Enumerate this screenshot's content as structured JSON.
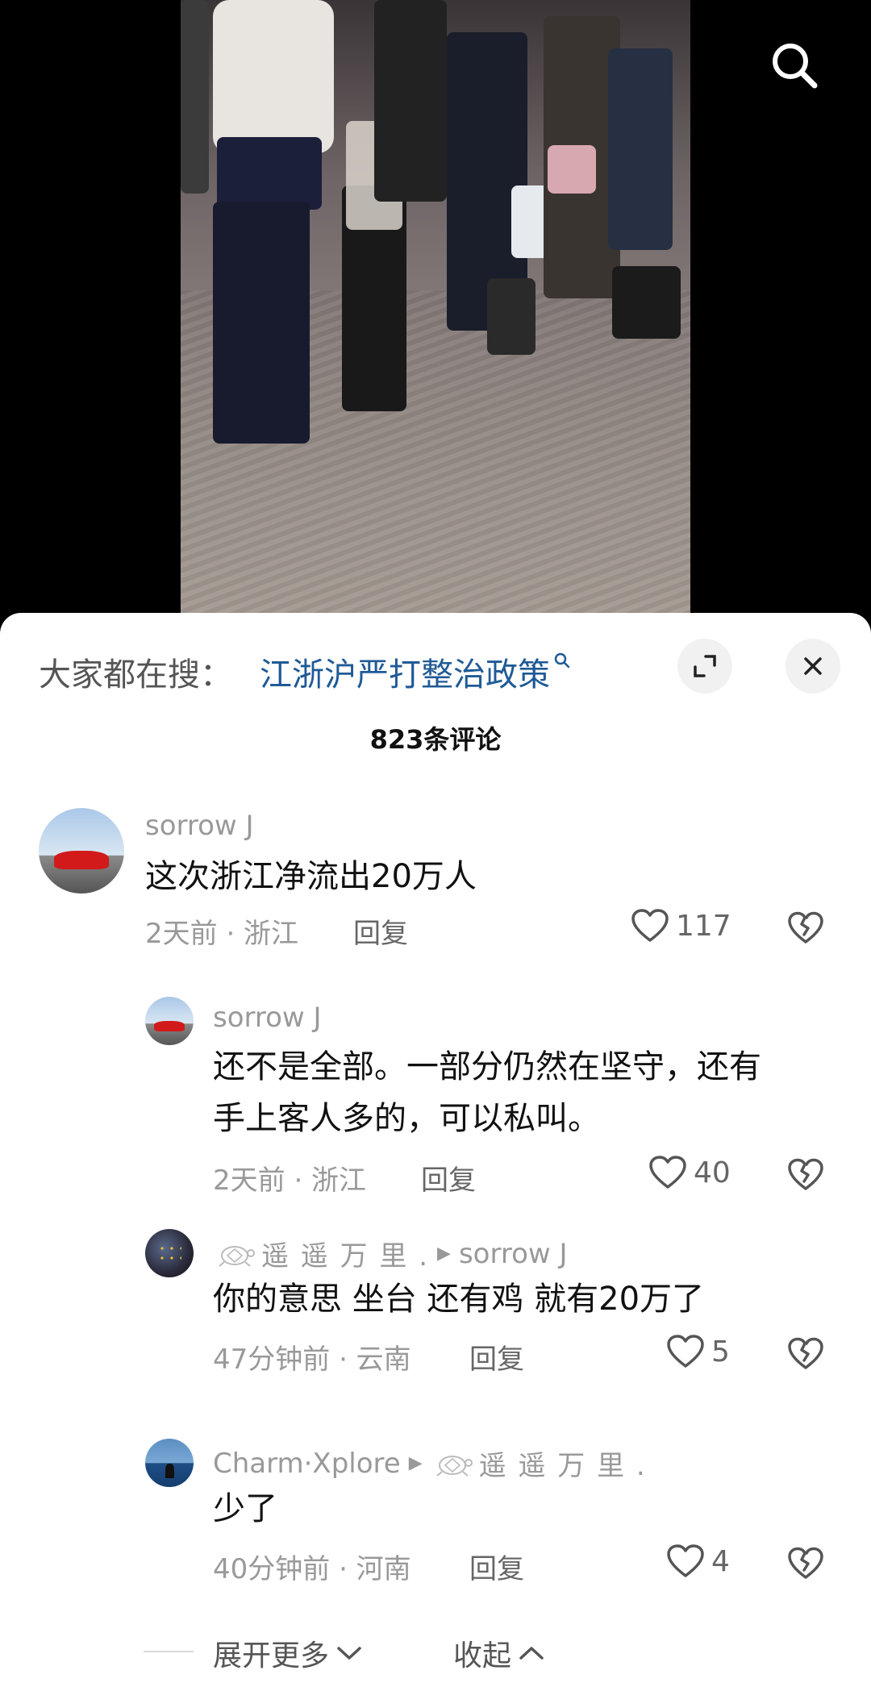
{
  "top": {
    "search_icon": "search-icon"
  },
  "sheet": {
    "hot_search_prefix": "大家都在搜：",
    "hot_search_link": "江浙沪严打整治政策",
    "comment_count": "823条评论"
  },
  "comments": [
    {
      "user": "sorrow J",
      "text": "这次浙江净流出20万人",
      "meta": "2天前 · 浙江",
      "reply": "回复",
      "likes": "117"
    },
    {
      "user": "sorrow J",
      "text_line1": "还不是全部。一部分仍然在坚守，还有",
      "text_line2": "手上客人多的，可以私叫。",
      "meta": "2天前 · 浙江",
      "reply": "回复",
      "likes": "40"
    },
    {
      "user": "遥 遥 万 里 .",
      "reply_to": "sorrow J",
      "text": "你的意思  坐台  还有鸡  就有20万了",
      "meta": "47分钟前 · 云南",
      "reply": "回复",
      "likes": "5"
    },
    {
      "user": "Charm·Xplore",
      "reply_to": "遥 遥 万 里 .",
      "text": "少了",
      "meta": "40分钟前 · 河南",
      "reply": "回复",
      "likes": "4"
    }
  ],
  "footer": {
    "expand": "展开更多",
    "collapse": "收起"
  },
  "colors": {
    "link": "#1f5a96",
    "muted": "#999999",
    "text": "#111111"
  }
}
